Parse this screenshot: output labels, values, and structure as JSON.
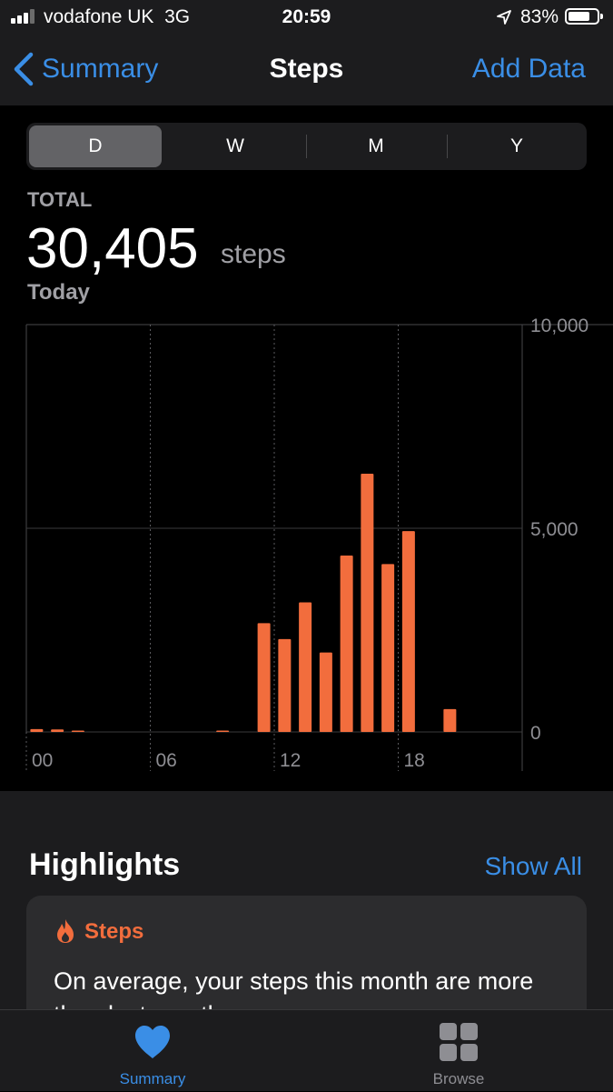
{
  "status_bar": {
    "carrier": "vodafone UK",
    "network": "3G",
    "time": "20:59",
    "battery": "83%",
    "battery_level": 0.83
  },
  "nav": {
    "back_label": "Summary",
    "title": "Steps",
    "action_label": "Add Data"
  },
  "segments": [
    {
      "label": "D",
      "active": true
    },
    {
      "label": "W",
      "active": false
    },
    {
      "label": "M",
      "active": false
    },
    {
      "label": "Y",
      "active": false
    }
  ],
  "summary": {
    "total_label": "TOTAL",
    "total_value": "30,405",
    "unit": "steps",
    "period": "Today"
  },
  "chart_data": {
    "type": "bar",
    "x": [
      0,
      1,
      2,
      3,
      4,
      5,
      6,
      7,
      8,
      9,
      10,
      11,
      12,
      13,
      14,
      15,
      16,
      17,
      18,
      19,
      20,
      21,
      22,
      23
    ],
    "values": [
      70,
      60,
      20,
      0,
      0,
      0,
      0,
      0,
      0,
      20,
      0,
      2670,
      2280,
      3180,
      1950,
      4330,
      6340,
      4120,
      4930,
      0,
      560,
      0,
      0,
      0
    ],
    "x_tick_labels": [
      "00",
      "06",
      "12",
      "18"
    ],
    "y_tick_labels": [
      "10,000",
      "5,000",
      "0"
    ],
    "ylim": [
      0,
      10000
    ],
    "bar_color": "#f26d3d",
    "grid": true
  },
  "highlights": {
    "title": "Highlights",
    "show_all": "Show All",
    "card_title": "Steps",
    "card_text": "On average, your steps this month are more than last month."
  },
  "tabs": [
    {
      "label": "Summary",
      "active": true,
      "icon": "heart-icon"
    },
    {
      "label": "Browse",
      "active": false,
      "icon": "grid-icon"
    }
  ],
  "colors": {
    "accent": "#3a8ee6",
    "steps": "#f26d3d",
    "inactive_tab": "#8e8e93"
  }
}
